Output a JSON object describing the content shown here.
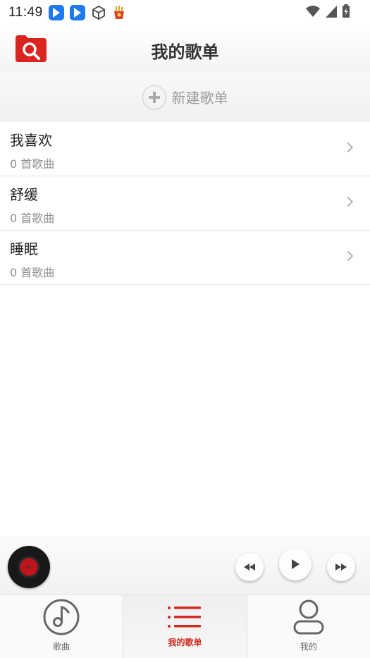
{
  "status_bar": {
    "time": "11:49"
  },
  "header": {
    "title": "我的歌单"
  },
  "new_playlist": {
    "label": "新建歌单"
  },
  "playlists": [
    {
      "name": "我喜欢",
      "count": "0 首歌曲"
    },
    {
      "name": "舒缓",
      "count": "0 首歌曲"
    },
    {
      "name": "睡眠",
      "count": "0 首歌曲"
    }
  ],
  "bottom_nav": [
    {
      "label": "歌曲",
      "icon": "music-note-icon",
      "active": false
    },
    {
      "label": "我的歌单",
      "icon": "list-icon",
      "active": true
    },
    {
      "label": "我的",
      "icon": "user-icon",
      "active": false
    }
  ],
  "colors": {
    "accent": "#d12a21",
    "notification_blue": "#1f7af0"
  }
}
